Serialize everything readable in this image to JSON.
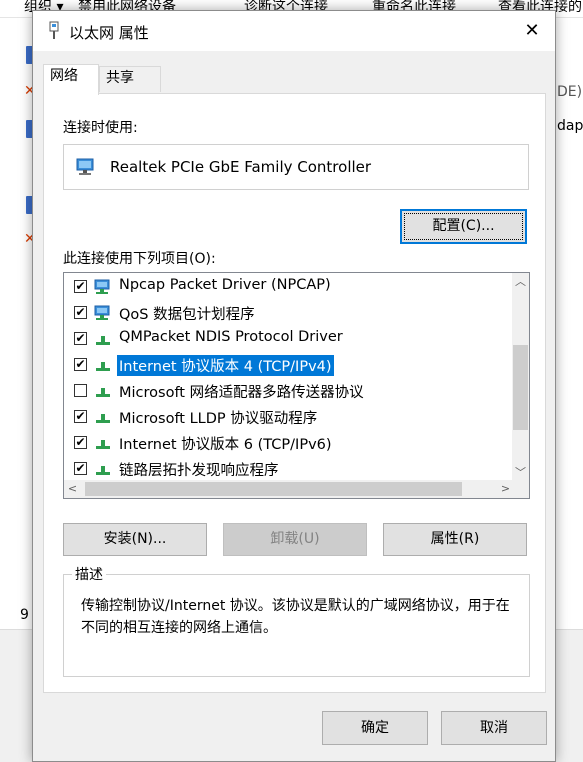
{
  "background_window": {
    "toolbar": [
      "组织 ▾",
      "禁用此网络设备",
      "诊断这个连接",
      "重命名此连接",
      "查看此连接的"
    ],
    "side_text": [
      "DE)",
      "dapt"
    ],
    "status_count": "9"
  },
  "dialog": {
    "title": "以太网 属性",
    "close_glyph": "✕",
    "tabs": [
      {
        "label": "网络",
        "active": true
      },
      {
        "label": "共享",
        "active": false
      }
    ],
    "connect_using_label": "连接时使用:",
    "adapter_name": "Realtek PCIe GbE Family Controller",
    "configure_button": "配置(C)...",
    "items_label": "此连接使用下列项目(O):",
    "items": [
      {
        "label": "Npcap Packet Driver (NPCAP)",
        "checked": true,
        "icon": "network-client-icon",
        "selected": false
      },
      {
        "label": "QoS 数据包计划程序",
        "checked": true,
        "icon": "network-client-icon",
        "selected": false
      },
      {
        "label": "QMPacket NDIS Protocol Driver",
        "checked": true,
        "icon": "protocol-icon",
        "selected": false
      },
      {
        "label": "Internet 协议版本 4 (TCP/IPv4)",
        "checked": true,
        "icon": "protocol-icon",
        "selected": true
      },
      {
        "label": "Microsoft 网络适配器多路传送器协议",
        "checked": false,
        "icon": "protocol-icon",
        "selected": false
      },
      {
        "label": "Microsoft LLDP 协议驱动程序",
        "checked": true,
        "icon": "protocol-icon",
        "selected": false
      },
      {
        "label": "Internet 协议版本 6 (TCP/IPv6)",
        "checked": true,
        "icon": "protocol-icon",
        "selected": false
      },
      {
        "label": "链路层拓扑发现响应程序",
        "checked": true,
        "icon": "protocol-icon",
        "selected": false
      }
    ],
    "check_glyph": "✔",
    "scroll_up": "︿",
    "scroll_down": "﹀",
    "scroll_left": "<",
    "scroll_right": ">",
    "install_button": "安装(N)...",
    "uninstall_button": "卸载(U)",
    "properties_button": "属性(R)",
    "description_legend": "描述",
    "description_text": "传输控制协议/Internet 协议。该协议是默认的广域网络协议，用于在不同的相互连接的网络上通信。",
    "ok_button": "确定",
    "cancel_button": "取消"
  },
  "colors": {
    "selection": "#0078d7",
    "dialog_bg": "#f0f0f0",
    "protocol_icon_green": "#2e9e4f",
    "network_icon_blue": "#3b8fd9"
  }
}
